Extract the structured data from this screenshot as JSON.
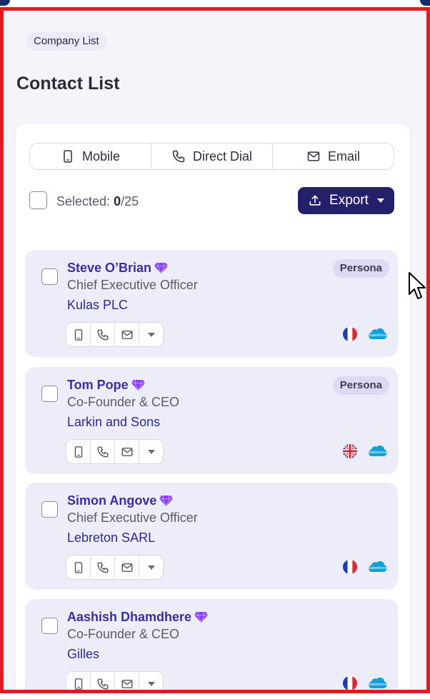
{
  "breadcrumb": {
    "label": "Company List"
  },
  "page_title": "Contact List",
  "filters": [
    {
      "label": "Mobile",
      "icon": "mobile-icon"
    },
    {
      "label": "Direct Dial",
      "icon": "phone-icon"
    },
    {
      "label": "Email",
      "icon": "mail-icon"
    }
  ],
  "selection": {
    "label": "Selected:",
    "count": "0",
    "total": "/25"
  },
  "export": {
    "label": "Export"
  },
  "colors": {
    "accent": "#24206a",
    "name": "#3b2fa0",
    "company": "#2d2a8c",
    "card_bg": "#ededfa",
    "gem": "#8a3ff0"
  },
  "contacts": [
    {
      "name": "Steve O’Brian",
      "title": "Chief Executive Officer",
      "company": "Kulas PLC",
      "badge": "Persona",
      "flag": "france-flag-icon"
    },
    {
      "name": "Tom Pope",
      "title": "Co-Founder & CEO",
      "company": "Larkin and Sons",
      "badge": "Persona",
      "flag": "uk-flag-icon"
    },
    {
      "name": "Simon Angove",
      "title": "Chief Executive Officer",
      "company": "Lebreton SARL",
      "badge": "",
      "flag": "france-flag-icon"
    },
    {
      "name": "Aashish Dhamdhere",
      "title": "Co-Founder & CEO",
      "company": "Gilles",
      "badge": "",
      "flag": "france-flag-icon"
    }
  ]
}
